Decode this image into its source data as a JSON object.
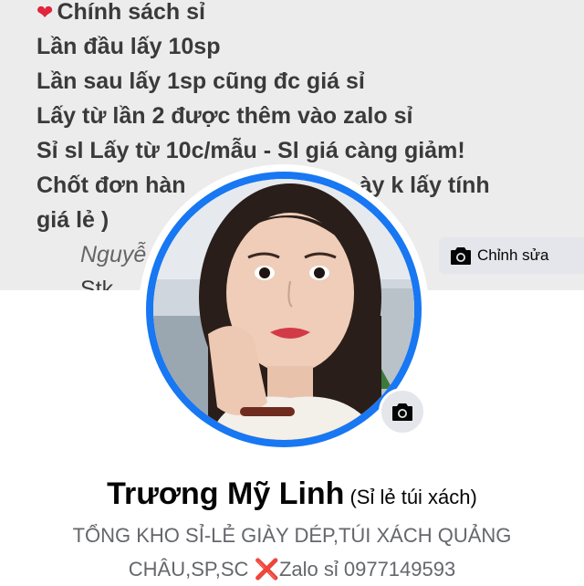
{
  "cover": {
    "lines": [
      "Chính sách sỉ",
      "Lần đầu lấy 10sp",
      "Lần sau lấy 1sp cũng đc giá sỉ",
      "Lấy từ lần 2 được thêm vào zalo sỉ",
      "Sỉ sl Lấy từ 10c/mẫu - Sl giá càng giảm!",
      "Chốt đơn hàn",
      "giá lẻ )",
      "Nguyễ",
      "Stk"
    ],
    "line6_tail": "ày k lấy tính",
    "heart_icon": "heart-icon",
    "edit_label": "Chỉnh sửa"
  },
  "profile": {
    "name": "Trương Mỹ Linh",
    "alternate_name": "(Sỉ lẻ túi xách)",
    "bio_line1": "TỔNG KHO SỈ-LẺ GIÀY DÉP,TÚI XÁCH QUẢNG",
    "bio_line2_a": "CHÂU,SP,SC",
    "bio_x": "❌",
    "bio_line2_b": "Zalo sỉ 0977149593"
  },
  "colors": {
    "accent": "#1877f2",
    "button_bg": "#e4e6eb",
    "secondary_text": "#65676b",
    "heart": "#e0243b"
  }
}
